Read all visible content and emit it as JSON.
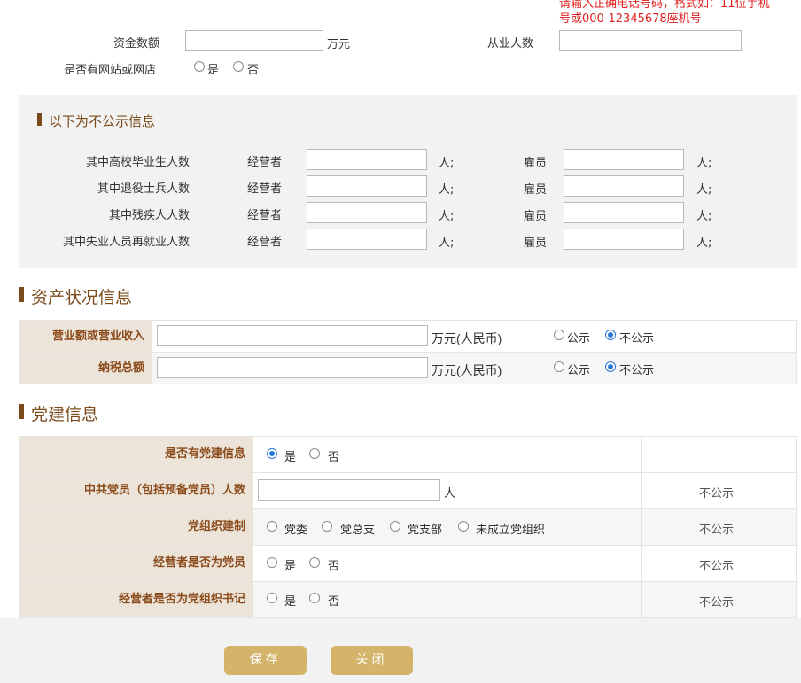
{
  "phone_hint": {
    "line1": "请输入正确电话号码，格式如：11位手机",
    "line2": "号或000-12345678座机号"
  },
  "basic": {
    "capital_label": "资金数额",
    "capital_unit": "万元",
    "employees_label": "从业人数",
    "website_label": "是否有网站或网店",
    "yes": "是",
    "no": "否"
  },
  "nonpublic": {
    "title": "以下为不公示信息",
    "operator_label": "经营者",
    "employee_label": "雇员",
    "unit": "人;",
    "rows": [
      {
        "label": "其中高校毕业生人数"
      },
      {
        "label": "其中退役士兵人数"
      },
      {
        "label": "其中残疾人人数"
      },
      {
        "label": "其中失业人员再就业人数"
      }
    ]
  },
  "assets": {
    "title": "资产状况信息",
    "rows": [
      {
        "label": "营业额或营业收入",
        "unit": "万元(人民币)",
        "public": "公示",
        "private": "不公示",
        "selected": "private"
      },
      {
        "label": "纳税总额",
        "unit": "万元(人民币)",
        "public": "公示",
        "private": "不公示",
        "selected": "private"
      }
    ]
  },
  "party": {
    "title": "党建信息",
    "rows": [
      {
        "label": "是否有党建信息",
        "status": ""
      },
      {
        "label": "中共党员（包括预备党员）人数",
        "unit": "人",
        "status": "不公示"
      },
      {
        "label": "党组织建制",
        "status": "不公示"
      },
      {
        "label": "经营者是否为党员",
        "status": "不公示"
      },
      {
        "label": "经营者是否为党组织书记",
        "status": "不公示"
      }
    ],
    "yes": "是",
    "no": "否",
    "org_options": [
      "党委",
      "党总支",
      "党支部",
      "未成立党组织"
    ]
  },
  "buttons": {
    "save": "保存",
    "close": "关闭"
  },
  "colors": {
    "accent_brown": "#7a4a1a",
    "button_gold": "#d4b46a",
    "hint_red": "#e02020",
    "radio_blue": "#2a78d6"
  }
}
